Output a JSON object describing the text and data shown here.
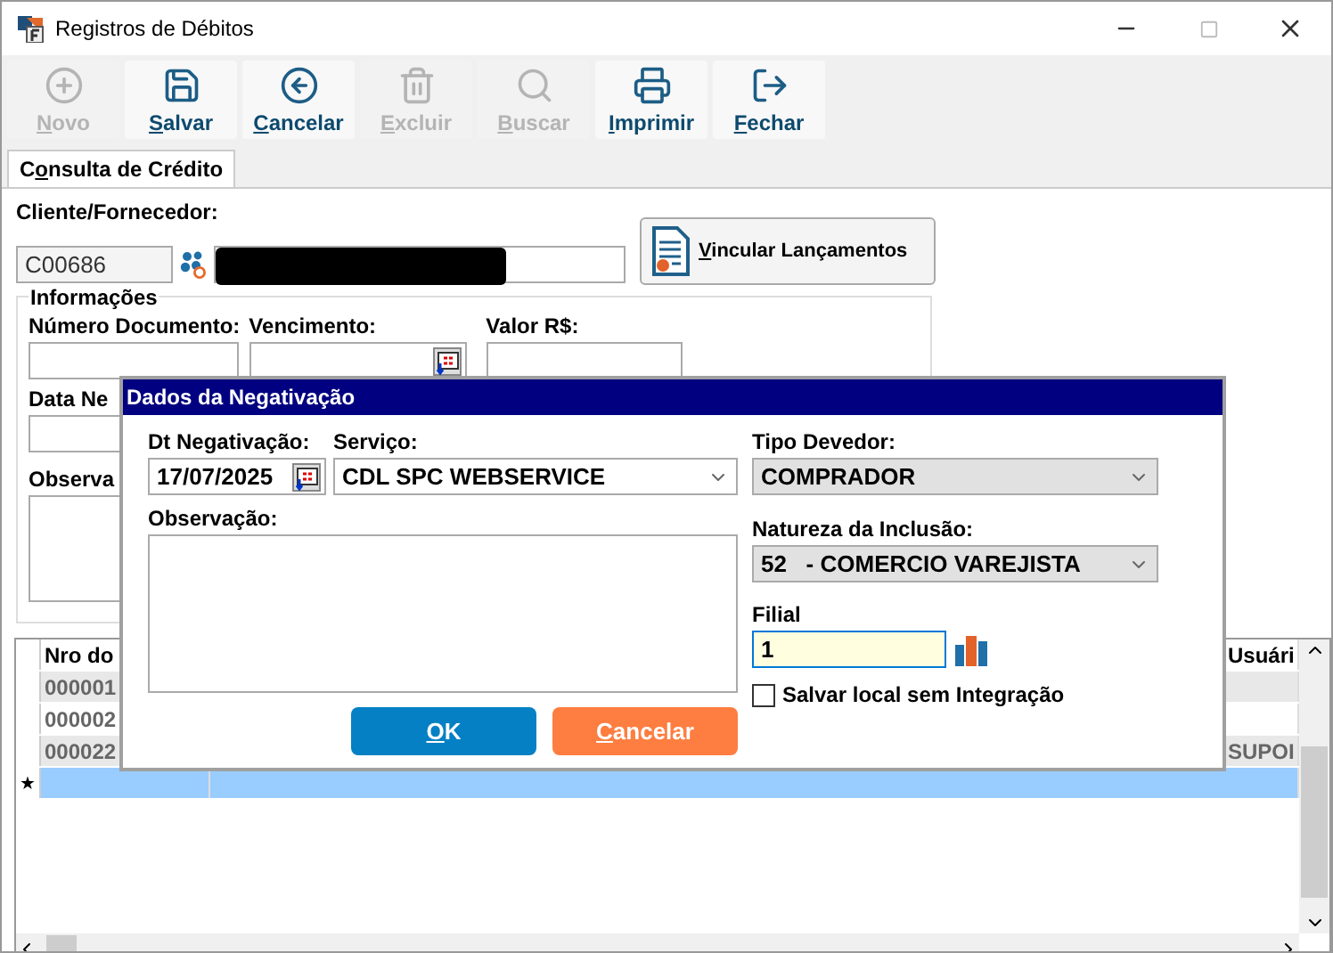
{
  "window": {
    "title": "Registros de Débitos"
  },
  "toolbar": [
    {
      "label": "Novo",
      "disabled": true
    },
    {
      "label": "Salvar",
      "disabled": false
    },
    {
      "label": "Cancelar",
      "disabled": false
    },
    {
      "label": "Excluir",
      "disabled": true
    },
    {
      "label": "Buscar",
      "disabled": true
    },
    {
      "label": "Imprimir",
      "disabled": false
    },
    {
      "label": "Fechar",
      "disabled": false
    }
  ],
  "tabs": [
    {
      "label": "Consulta de Crédito",
      "selected": true
    }
  ],
  "client": {
    "label": "Cliente/Fornecedor:",
    "code": "C00686",
    "link_button": {
      "label": "Vincular Lançamentos"
    }
  },
  "info_group": {
    "title": "Informações",
    "document_label": "Número Documento:",
    "due_label": "Vencimento:",
    "value_label": "Valor R$:",
    "date_label": "Data Ne",
    "notes_label": "Observa"
  },
  "grid": {
    "first_column": "Nro do",
    "last_column": "Usuári",
    "rows": [
      {
        "number": "000001",
        "shaded": true,
        "selected": false
      },
      {
        "number": "000002",
        "shaded": false,
        "selected": false
      },
      {
        "number": "000022",
        "user": "SUPOI",
        "shaded": true,
        "selected": false
      },
      {
        "marker": "★",
        "selected": true
      }
    ]
  },
  "dialog": {
    "title": "Dados da Negativação",
    "date_label": "Dt Negativação:",
    "date": "17/07/2025",
    "service_label": "Serviço:",
    "service": "CDL SPC WEBSERVICE",
    "notes_label": "Observação:",
    "debtor_label": "Tipo Devedor:",
    "debtor": "COMPRADOR",
    "nature_label": "Natureza da Inclusão:",
    "nature": "52   - COMERCIO VAREJISTA",
    "branch_label": "Filial",
    "branch": "1",
    "local_save": {
      "label": "Salvar local sem Integração",
      "checked": false
    },
    "buttons": [
      {
        "label": "OK",
        "kind": "primary"
      },
      {
        "label": "Cancelar",
        "kind": "danger"
      }
    ]
  }
}
